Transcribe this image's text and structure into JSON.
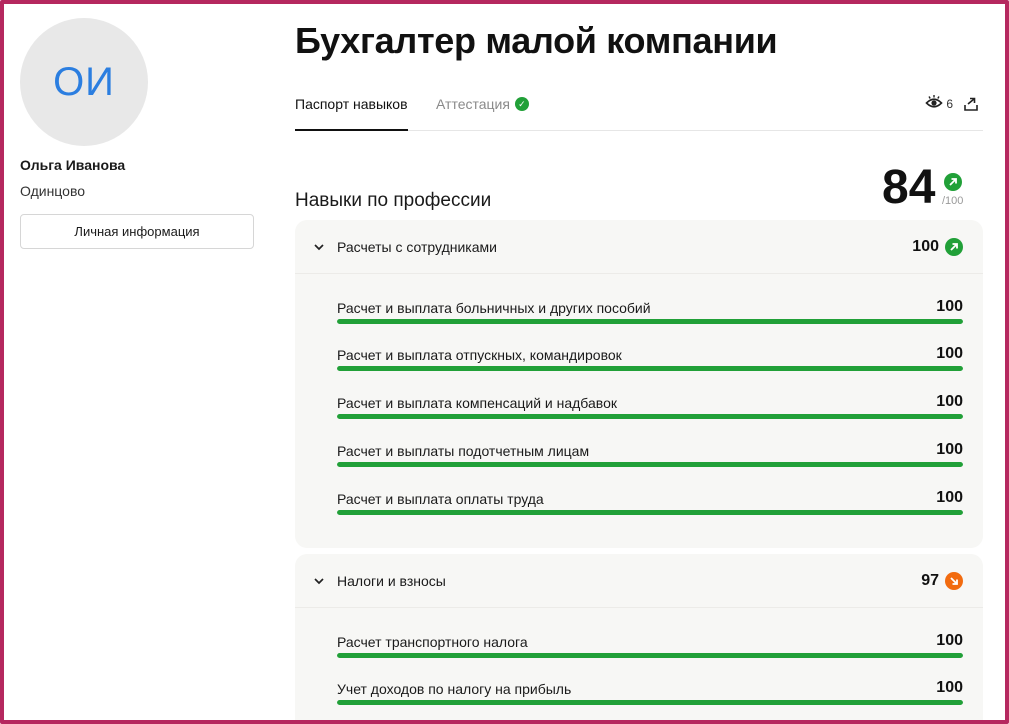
{
  "profile": {
    "initials": "ОИ",
    "name": "Ольга Иванова",
    "city": "Одинцово",
    "personal_info_button": "Личная информация"
  },
  "header": {
    "title": "Бухгалтер малой компании",
    "tabs": [
      {
        "label": "Паспорт навыков",
        "active": true
      },
      {
        "label": "Аттестация",
        "active": false,
        "badge": "check-icon"
      }
    ],
    "views_count": "6"
  },
  "skills_section": {
    "title": "Навыки по профессии",
    "total_score": "84",
    "total_of": "/100",
    "trend": "up"
  },
  "groups": [
    {
      "name": "Расчеты с сотрудниками",
      "score": "100",
      "trend": "up",
      "skills": [
        {
          "name": "Расчет и выплата больничных и других пособий",
          "score": "100",
          "progress": 1.0
        },
        {
          "name": "Расчет и выплата отпускных, командировок",
          "score": "100",
          "progress": 1.0
        },
        {
          "name": "Расчет и выплата компенсаций и надбавок",
          "score": "100",
          "progress": 1.0
        },
        {
          "name": "Расчет и выплаты подотчетным лицам",
          "score": "100",
          "progress": 1.0
        },
        {
          "name": "Расчет и выплата оплаты труда",
          "score": "100",
          "progress": 1.0
        }
      ]
    },
    {
      "name": "Налоги и взносы",
      "score": "97",
      "trend": "down",
      "skills": [
        {
          "name": "Расчет транспортного налога",
          "score": "100",
          "progress": 1.0
        },
        {
          "name": "Учет доходов по налогу на прибыль",
          "score": "100",
          "progress": 1.0
        }
      ]
    }
  ],
  "colors": {
    "accent_green": "#21a038",
    "trend_down_orange": "#f26b0f",
    "avatar_text": "#2b7ee0",
    "frame_border": "#b5285f"
  }
}
